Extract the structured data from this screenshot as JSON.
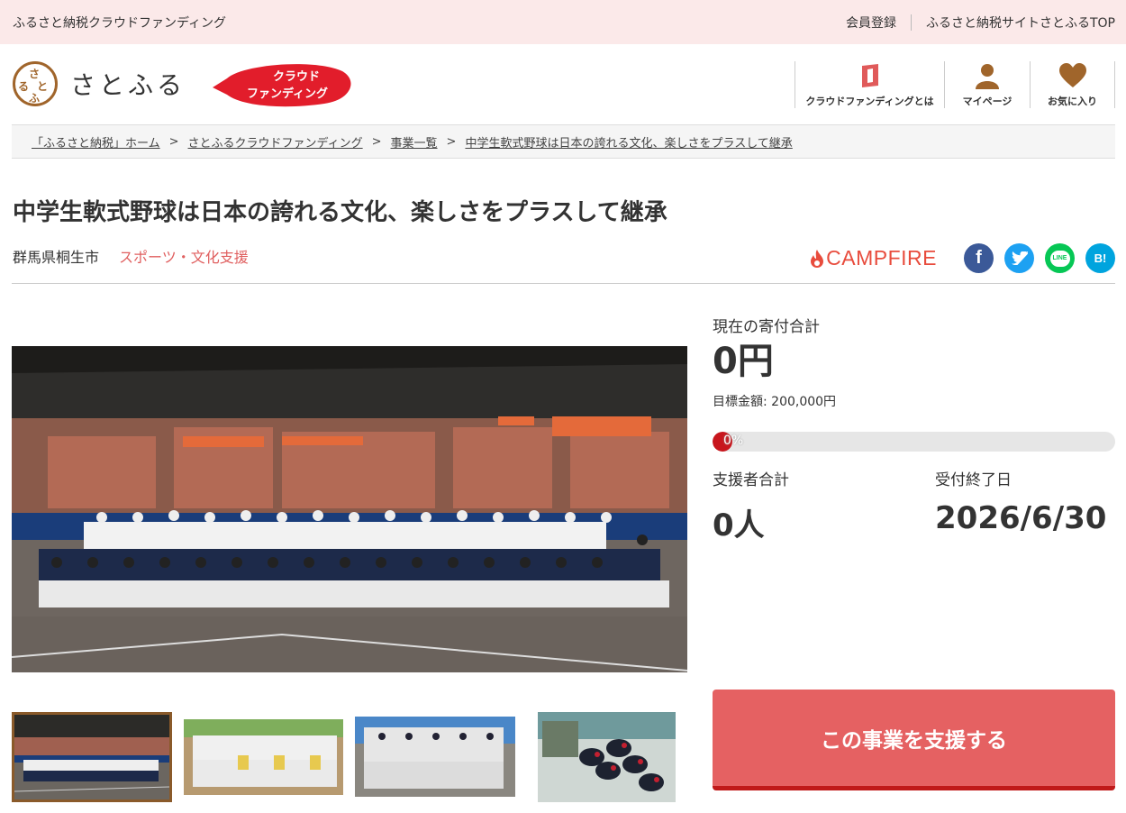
{
  "topbar": {
    "left_text": "ふるさと納税クラウドファンディング",
    "register": "会員登録",
    "top_link": "ふるさと納税サイトさとふるTOP"
  },
  "header": {
    "logo_text": "さとふる",
    "logo_mark": [
      "さ",
      "と",
      "ふ",
      "る"
    ],
    "badge_line1": "クラウド",
    "badge_line2": "ファンディング",
    "nav": [
      {
        "label": "クラウドファンディングとは",
        "icon": "book-icon"
      },
      {
        "label": "マイページ",
        "icon": "user-icon"
      },
      {
        "label": "お気に入り",
        "icon": "heart-icon"
      }
    ],
    "accent": "#b5652a"
  },
  "breadcrumb": [
    "「ふるさと納税」ホーム",
    "さとふるクラウドファンディング",
    "事業一覧",
    "中学生軟式野球は日本の誇れる文化、楽しさをプラスして継承"
  ],
  "breadcrumb_sep": ">",
  "project": {
    "title": "中学生軟式野球は日本の誇れる文化、楽しさをプラスして継承",
    "city": "群馬県桐生市",
    "category": "スポーツ・文化支援",
    "partner": "CAMPFIRE"
  },
  "share": {
    "facebook": "f",
    "line": "LINE",
    "hatena": "B!"
  },
  "stats": {
    "total_label": "現在の寄付合計",
    "total_value": "0円",
    "goal_text": "目標金額: 200,000円",
    "progress_text": "0%",
    "progress": 0,
    "supporters_label": "支援者合計",
    "supporters_value": "0人",
    "deadline_label": "受付終了日",
    "deadline_value": "2026/6/30"
  },
  "cta": {
    "label": "この事業を支援する",
    "color": "#e56162"
  },
  "colors": {
    "topbar_bg": "#fbe9e9",
    "category": "#e06060",
    "campfire": "#e84c3d"
  }
}
